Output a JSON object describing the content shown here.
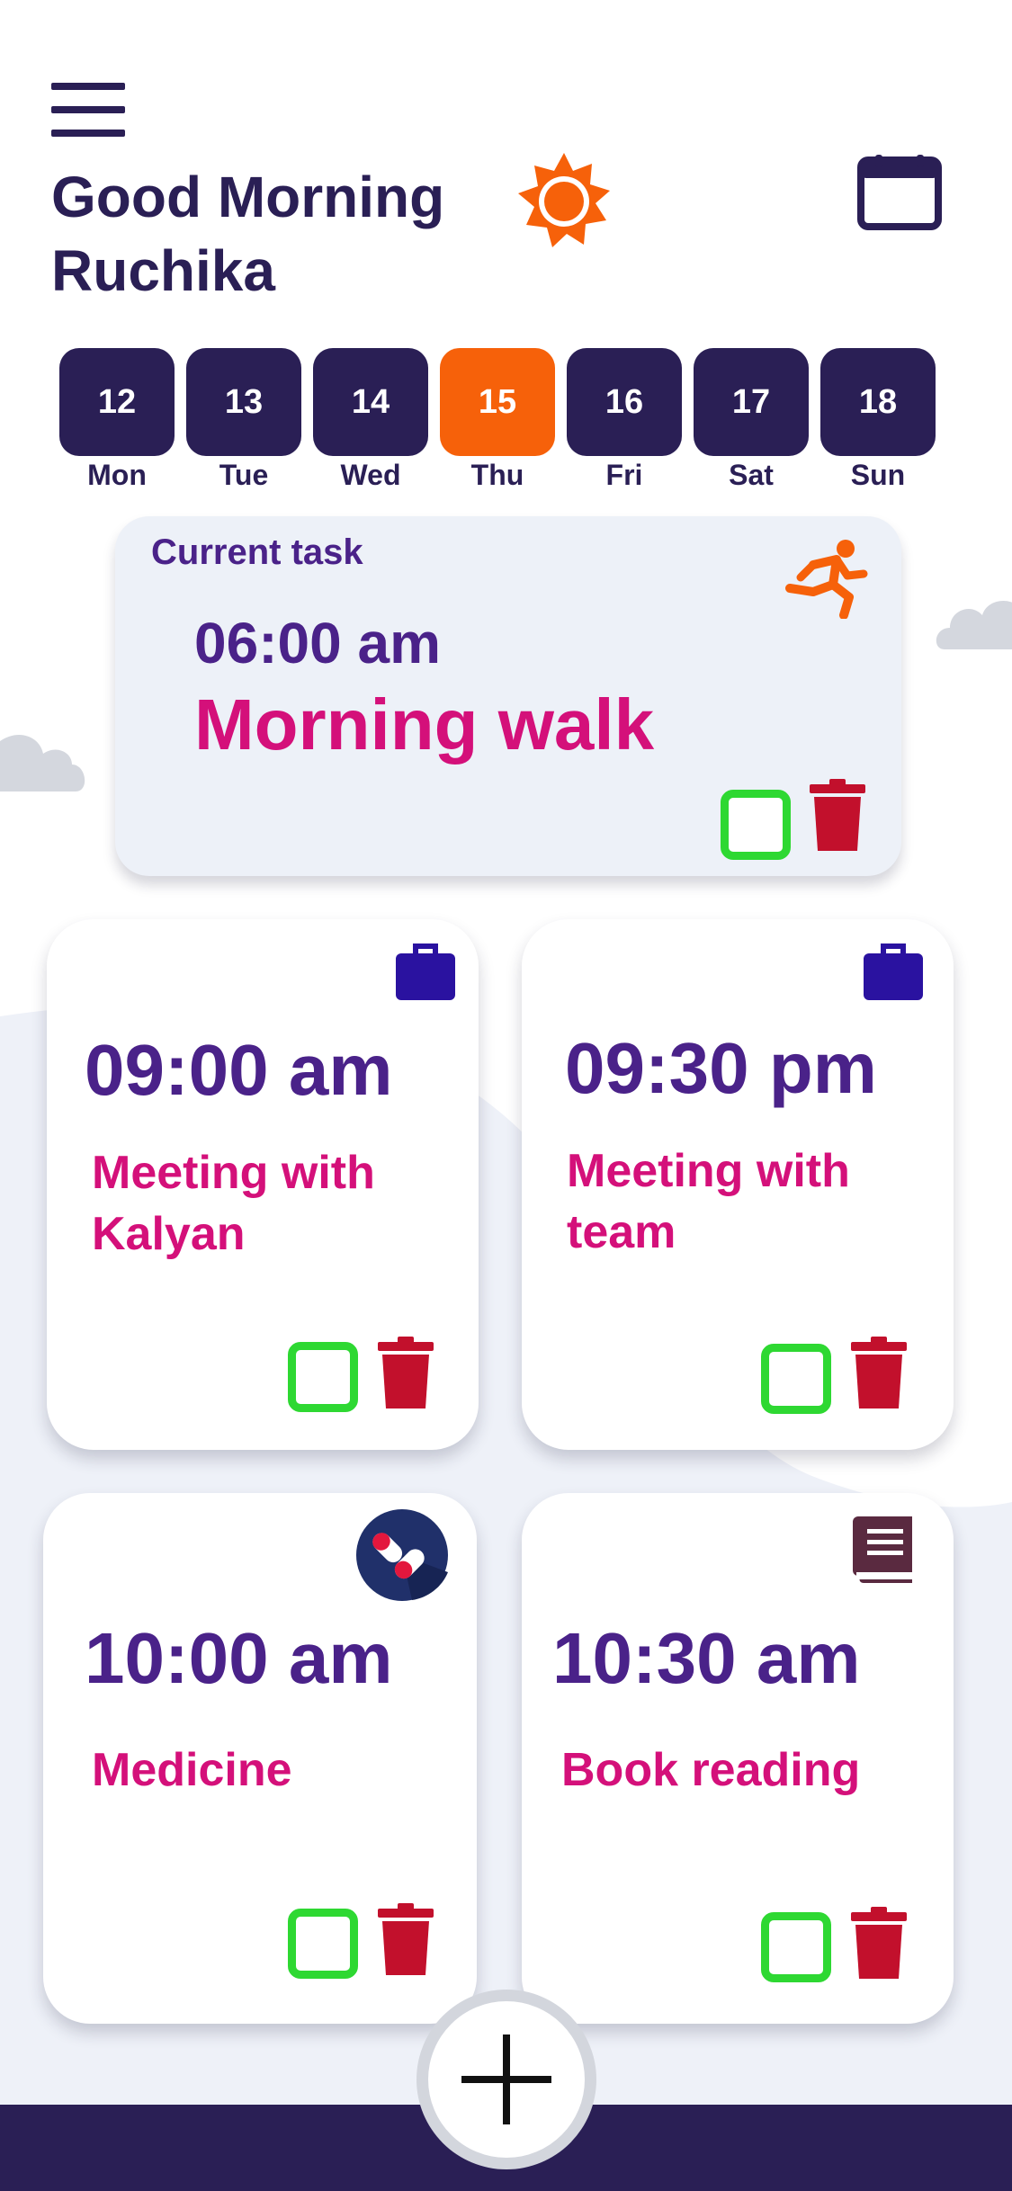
{
  "header": {
    "greeting_line1": "Good Morning",
    "greeting_line2": "Ruchika",
    "menu_icon": "hamburger-menu-icon",
    "weather_icon": "sun-icon",
    "calendar_icon": "calendar-icon"
  },
  "days": [
    {
      "date": "12",
      "label": "Mon",
      "active": false
    },
    {
      "date": "13",
      "label": "Tue",
      "active": false
    },
    {
      "date": "14",
      "label": "Wed",
      "active": false
    },
    {
      "date": "15",
      "label": "Thu",
      "active": true
    },
    {
      "date": "16",
      "label": "Fri",
      "active": false
    },
    {
      "date": "17",
      "label": "Sat",
      "active": false
    },
    {
      "date": "18",
      "label": "Sun",
      "active": false
    }
  ],
  "current_task": {
    "label": "Current task",
    "time": "06:00 am",
    "title": "Morning walk",
    "icon": "running-icon"
  },
  "tasks": [
    {
      "time": "09:00 am",
      "title_line1": "Meeting with",
      "title_line2": "Kalyan",
      "icon": "briefcase-icon"
    },
    {
      "time": "09:30 pm",
      "title_line1": "Meeting with",
      "title_line2": "team",
      "icon": "briefcase-icon"
    },
    {
      "time": "10:00 am",
      "title_line1": "Medicine",
      "title_line2": "",
      "icon": "pills-icon"
    },
    {
      "time": "10:30 am",
      "title_line1": "Book reading",
      "title_line2": "",
      "icon": "book-icon"
    }
  ],
  "colors": {
    "primary": "#2a1f55",
    "accent": "#f6610a",
    "task_time": "#4a2289",
    "task_title": "#d4107a",
    "checkbox": "#2ed832",
    "trash": "#c2102c"
  }
}
